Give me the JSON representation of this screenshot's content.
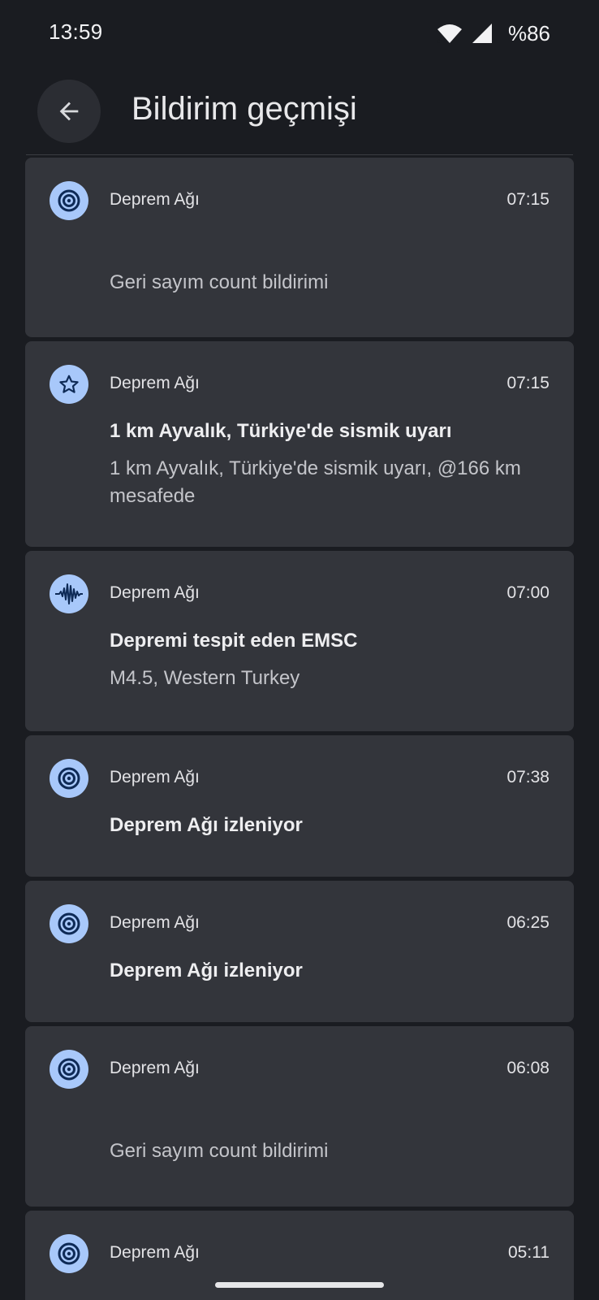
{
  "status_bar": {
    "time": "13:59",
    "wifi_badge": "5",
    "battery": "%86",
    "icons": [
      "wifi-icon",
      "signal-icon"
    ]
  },
  "header": {
    "back_icon": "arrow-back-icon",
    "title": "Bildirim geçmişi"
  },
  "colors": {
    "background": "#1a1c21",
    "card": "#33353b",
    "icon_badge": "#a8c8fa",
    "icon_glyph": "#0e2a56"
  },
  "notifications": [
    {
      "icon": "target-icon",
      "app": "Deprem Ağı",
      "time": "07:15",
      "title": "",
      "text": "Geri sayım count bildirimi"
    },
    {
      "icon": "star-icon",
      "app": "Deprem Ağı",
      "time": "07:15",
      "title": "1 km Ayvalık, Türkiye'de sismik uyarı",
      "text": "1 km Ayvalık, Türkiye'de sismik uyarı, @166 km mesafede"
    },
    {
      "icon": "waveform-icon",
      "app": "Deprem Ağı",
      "time": "07:00",
      "title": "Depremi tespit eden EMSC",
      "text": "M4.5, Western Turkey"
    },
    {
      "icon": "target-icon",
      "app": "Deprem Ağı",
      "time": "07:38",
      "title": "Deprem Ağı izleniyor",
      "text": ""
    },
    {
      "icon": "target-icon",
      "app": "Deprem Ağı",
      "time": "06:25",
      "title": "Deprem Ağı izleniyor",
      "text": ""
    },
    {
      "icon": "target-icon",
      "app": "Deprem Ağı",
      "time": "06:08",
      "title": "",
      "text": "Geri sayım count bildirimi"
    },
    {
      "icon": "target-icon",
      "app": "Deprem Ağı",
      "time": "05:11",
      "title": "",
      "text": ""
    }
  ]
}
